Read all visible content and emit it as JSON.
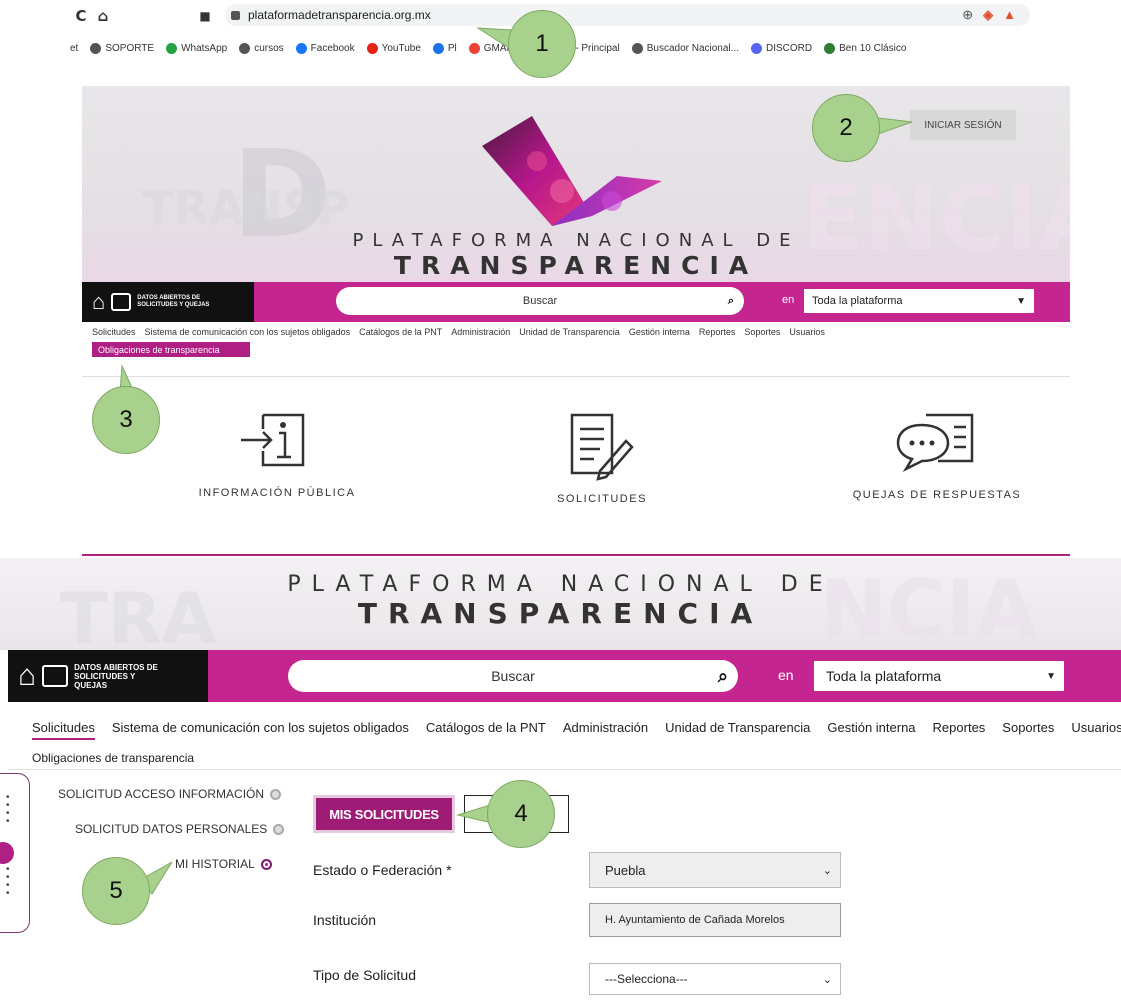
{
  "browser": {
    "url": "plataformadetransparencia.org.mx",
    "bookmarks": [
      {
        "label": "et",
        "color": "#ffffff"
      },
      {
        "label": "SOPORTE",
        "color": "#555555"
      },
      {
        "label": "WhatsApp",
        "color": "#25a244"
      },
      {
        "label": "cursos",
        "color": "#555555"
      },
      {
        "label": "Facebook",
        "color": "#1877f2"
      },
      {
        "label": "YouTube",
        "color": "#e62117"
      },
      {
        "label": "Pl",
        "color": "#1a73e8"
      },
      {
        "label": "GMAIL",
        "color": "#ea4335"
      },
      {
        "label": "cPanel - Principal",
        "color": "#ff6c2c"
      },
      {
        "label": "Buscador Nacional...",
        "color": "#555555"
      },
      {
        "label": "DISCORD",
        "color": "#5865f2"
      },
      {
        "label": "Ben 10 Clásico",
        "color": "#2e7d32"
      }
    ]
  },
  "site_top": {
    "login_label": "INICIAR SESIÓN",
    "title_line1": "PLATAFORMA NACIONAL DE",
    "title_line2": "TRANSPARENCIA",
    "home_text": "DATOS ABIERTOS DE SOLICITUDES Y QUEJAS",
    "search_placeholder": "Buscar",
    "en_label": "en",
    "scope_value": "Toda la plataforma",
    "menu": [
      "Solicitudes",
      "Sistema de comunicación con los sujetos obligados",
      "Catálogos de la PNT",
      "Administración",
      "Unidad de Transparencia",
      "Gestión interna",
      "Reportes",
      "Soportes",
      "Usuarios"
    ],
    "obligaciones": "Obligaciones de transparencia",
    "cards": [
      "INFORMACIÓN PÚBLICA",
      "SOLICITUDES",
      "QUEJAS DE RESPUESTAS"
    ]
  },
  "site_bottom": {
    "title_line1": "PLATAFORMA NACIONAL DE",
    "title_line2": "TRANSPARENCIA",
    "home_text": "DATOS ABIERTOS DE SOLICITUDES Y QUEJAS",
    "search_placeholder": "Buscar",
    "en_label": "en",
    "scope_value": "Toda la plataforma",
    "menu": [
      "Solicitudes",
      "Sistema de comunicación con los sujetos obligados",
      "Catálogos de la PNT",
      "Administración",
      "Unidad de Transparencia",
      "Gestión interna",
      "Reportes",
      "Soportes",
      "Usuarios"
    ],
    "obligaciones": "Obligaciones de transparencia",
    "side_options": [
      "SOLICITUD ACCESO INFORMACIÓN",
      "SOLICITUD DATOS PERSONALES",
      "MI HISTORIAL"
    ],
    "mis_solicitudes": "MIS SOLICITUDES",
    "form": {
      "estado_label": "Estado o Federación *",
      "estado_value": "Puebla",
      "institucion_label": "Institución",
      "institucion_value": "H. Ayuntamiento de Cañada Morelos",
      "tipo_label": "Tipo de Solicitud",
      "tipo_value": "---Selecciona---"
    }
  },
  "callouts": [
    "1",
    "2",
    "3",
    "4",
    "5"
  ],
  "colors": {
    "brand": "#c5258f",
    "callout": "#a9d18e"
  }
}
